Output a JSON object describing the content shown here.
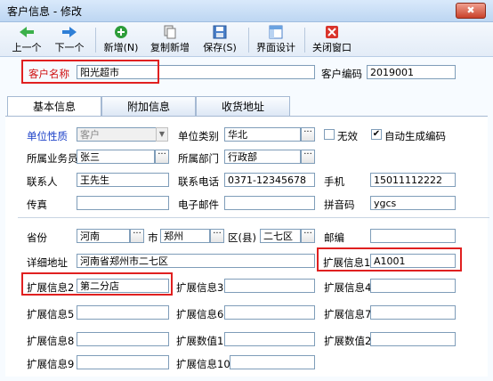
{
  "window": {
    "title": "客户信息 - 修改",
    "close_label": "✖"
  },
  "toolbar": {
    "prev": "上一个",
    "next": "下一个",
    "add": "新增(N)",
    "copy_add": "复制新增",
    "save": "保存(S)",
    "design": "界面设计",
    "close": "关闭窗口"
  },
  "header": {
    "customer_name_label": "客户名称",
    "customer_name_value": "阳光超市",
    "customer_code_label": "客户编码",
    "customer_code_value": "2019001"
  },
  "tabs": [
    "基本信息",
    "附加信息",
    "收货地址"
  ],
  "form": {
    "unit_nature_label": "单位性质",
    "unit_nature_value": "客户",
    "unit_category_label": "单位类别",
    "unit_category_value": "华北",
    "invalid_label": "无效",
    "invalid_checked": false,
    "auto_code_label": "自动生成编码",
    "auto_code_checked": true,
    "salesman_label": "所属业务员",
    "salesman_value": "张三",
    "department_label": "所属部门",
    "department_value": "行政部",
    "contact_label": "联系人",
    "contact_value": "王先生",
    "phone_label": "联系电话",
    "phone_value": "0371-12345678",
    "mobile_label": "手机",
    "mobile_value": "15011112222",
    "fax_label": "传真",
    "fax_value": "",
    "email_label": "电子邮件",
    "email_value": "",
    "pinyin_label": "拼音码",
    "pinyin_value": "ygcs",
    "province_label": "省份",
    "province_value": "河南",
    "city_label": "市",
    "city_value": "郑州",
    "district_label": "区(县)",
    "district_value": "二七区",
    "postcode_label": "邮编",
    "postcode_value": "",
    "address_label": "详细地址",
    "address_value": "河南省郑州市二七区",
    "ext1_label": "扩展信息1",
    "ext1_value": "A1001",
    "ext2_label": "扩展信息2",
    "ext2_value": "第二分店",
    "ext3_label": "扩展信息3",
    "ext3_value": "",
    "ext4_label": "扩展信息4",
    "ext4_value": "",
    "ext5_label": "扩展信息5",
    "ext5_value": "",
    "ext6_label": "扩展信息6",
    "ext6_value": "",
    "ext7_label": "扩展信息7",
    "ext7_value": "",
    "ext8_label": "扩展信息8",
    "ext8_value": "",
    "num1_label": "扩展数值1",
    "num1_value": "",
    "num2_label": "扩展数值2",
    "num2_value": "",
    "ext9_label": "扩展信息9",
    "ext9_value": "",
    "ext10_label": "扩展信息10",
    "ext10_value": ""
  }
}
